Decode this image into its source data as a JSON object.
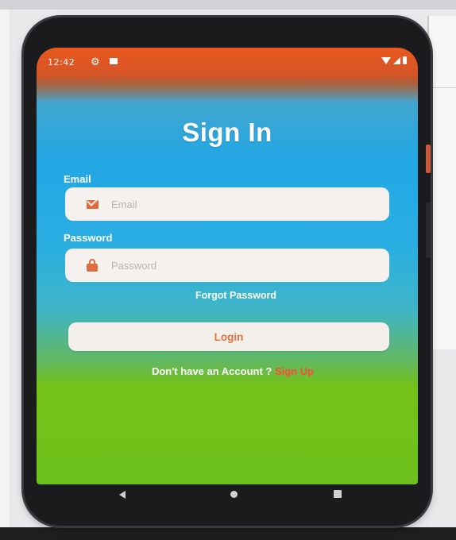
{
  "status_bar": {
    "time": "12:42",
    "icons": [
      "settings-gear-icon",
      "sim-card-icon",
      "wifi-icon",
      "signal-icon",
      "battery-icon"
    ]
  },
  "signin": {
    "title": "Sign In",
    "email": {
      "label": "Email",
      "placeholder": "Email",
      "value": "",
      "icon": "mail-icon"
    },
    "password": {
      "label": "Password",
      "placeholder": "Password",
      "value": "",
      "icon": "lock-icon"
    },
    "forgot_password": "Forgot Password",
    "login_label": "Login",
    "signup_prompt": "Don't have an Account ?",
    "signup_link": "Sign Up"
  },
  "nav_bar": {
    "icons": [
      "back-icon",
      "home-icon",
      "recents-icon"
    ]
  },
  "colors": {
    "accent": "#e2723f",
    "signup_link": "#ff4a3c",
    "gradient_top": "#22a7e4",
    "gradient_bottom": "#74c218",
    "status_bar_orange": "#ea5a1e"
  }
}
